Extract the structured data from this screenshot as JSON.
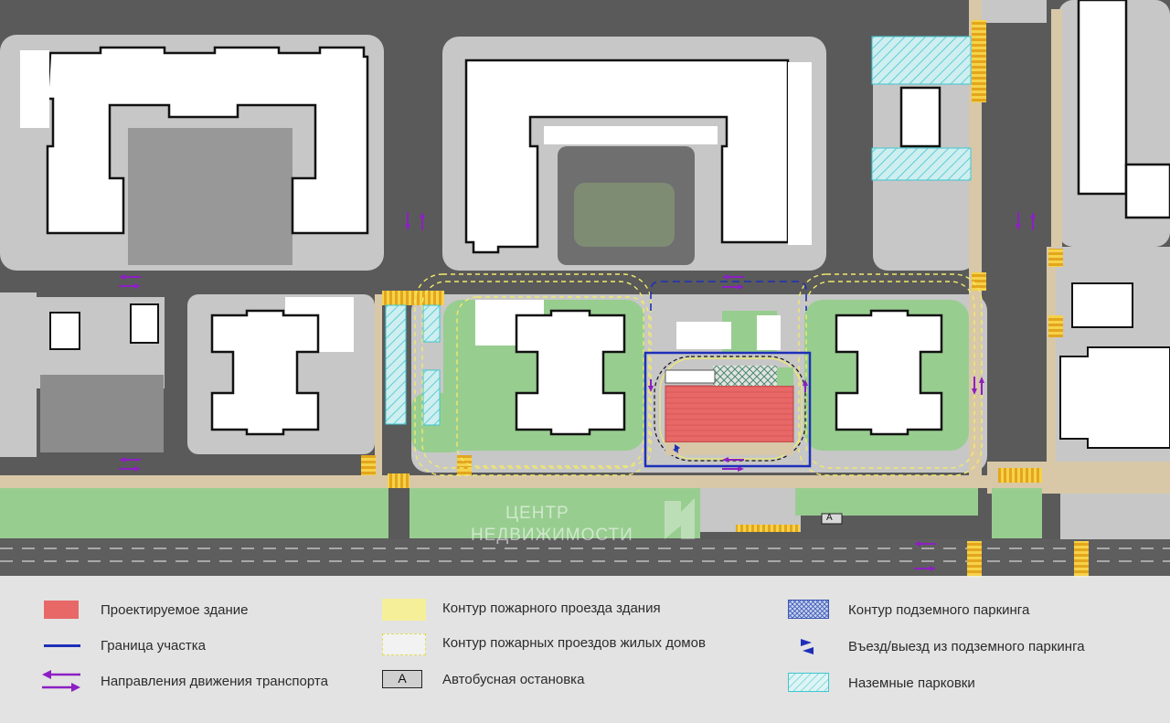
{
  "legend": {
    "items": [
      {
        "key": "designed_building",
        "label": "Проектируемое здание",
        "icon": "red-fill-swatch",
        "color": "#e86868"
      },
      {
        "key": "site_boundary",
        "label": "Граница участка",
        "icon": "blue-line",
        "color": "#1d2fb8"
      },
      {
        "key": "traffic",
        "label": "Направления движения транспорта",
        "icon": "purple-arrows",
        "color": "#8d1fc4"
      },
      {
        "key": "fire_building",
        "label": "Контур пожарного проезда здания",
        "icon": "yellow-fill-swatch",
        "color": "#f6ef9a"
      },
      {
        "key": "fire_residential",
        "label": "Контур пожарных проездов жилых домов",
        "icon": "yellow-dashed-swatch",
        "color": "#e0db5a"
      },
      {
        "key": "bus_stop",
        "label": "Автобусная остановка",
        "icon": "bus-stop-box",
        "symbol": "A"
      },
      {
        "key": "underground_parking",
        "label": "Контур подземного паркинга",
        "icon": "blue-hatch-swatch",
        "color": "#3a56b8"
      },
      {
        "key": "parking_entrance",
        "label": "Въезд/выезд из подземного паркинга",
        "icon": "blue-triangles",
        "color": "#1d2fb8"
      },
      {
        "key": "ground_parking",
        "label": "Наземные парковки",
        "icon": "cyan-hatch-swatch",
        "color": "#3fc7cf"
      }
    ]
  },
  "map": {
    "bus_stop_label": "A"
  },
  "watermark": {
    "line1": "ЦЕНТР",
    "line2": "НЕДВИЖИМОСТИ"
  }
}
